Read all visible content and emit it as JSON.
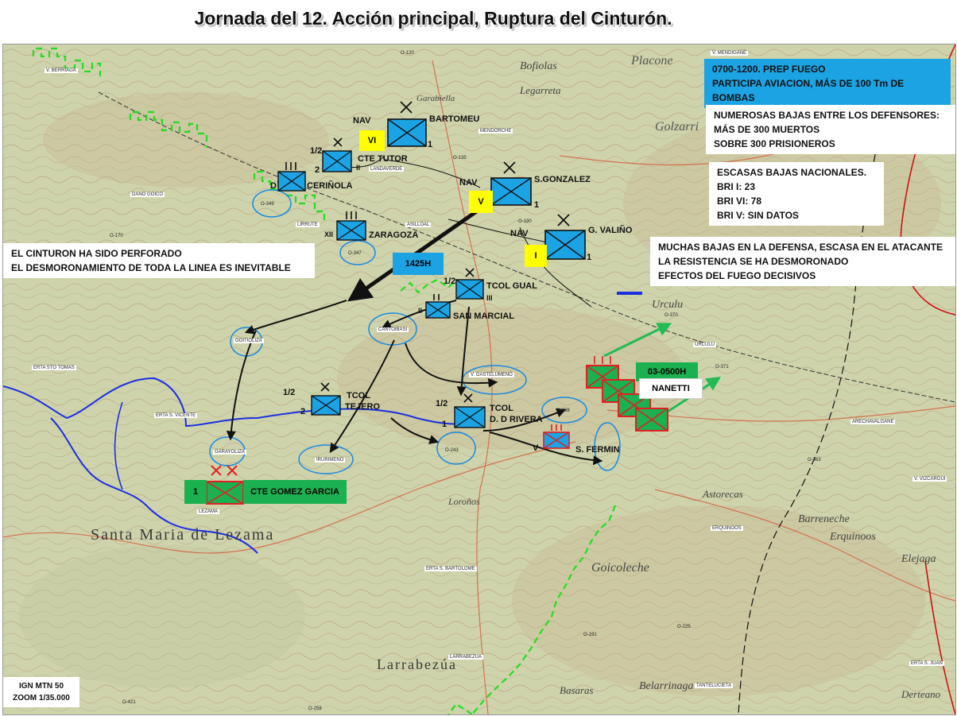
{
  "title": "Jornada del 12. Acción principal, Ruptura del Cinturón.",
  "colors": {
    "friendly": "#1ba3e4",
    "enemy": "#e02020",
    "enemy_fill": "#1bb050",
    "front": "#22dd22",
    "river": "#1a2fe0",
    "border": "#cc1111",
    "arrow": "#111111",
    "annotation_blue": "#1ba3e4"
  },
  "info_boxes": {
    "prep_fuego": [
      "0700-1200.  PREP FUEGO",
      "PARTICIPA AVIACION, MÁS DE 100 Tm DE BOMBAS"
    ],
    "bajas_def": [
      "NUMEROSAS BAJAS ENTRE LOS DEFENSORES:",
      "MÁS DE 300 MUERTOS",
      "SOBRE 300 PRISIONEROS"
    ],
    "bajas_nac": [
      "ESCASAS BAJAS NACIONALES.",
      "BRI I: 23",
      "BRI VI: 78",
      "BRI V: SIN DATOS"
    ],
    "resistencia": [
      "MUCHAS BAJAS EN LA DEFENSA, ESCASA EN EL ATACANTE",
      "LA RESISTENCIA SE HA DESMORONADO",
      "EFECTOS DEL FUEGO DECISIVOS"
    ],
    "cinturon": [
      "EL CINTURON HA SIDO PERFORADO",
      "EL DESMORONAMIENTO DE TODA LA LINEA ES INEVITABLE"
    ],
    "ign": [
      "IGN MTN 50",
      "ZOOM 1/35.000"
    ]
  },
  "tags": {
    "vi": "VI",
    "v": "V",
    "i": "I",
    "t1425": "1425H",
    "t0305": "03-0500H",
    "nanetti": "NANETTI",
    "gomez_num": "1",
    "gomez": "CTE GOMEZ GARCIA"
  },
  "units": {
    "bartomeu": {
      "name": "BARTOMEU",
      "nav": "NAV",
      "num": "1"
    },
    "tutor": {
      "name": "CTE TUTOR",
      "pre": "1/2",
      "num": "2",
      "suffix": "II"
    },
    "ceriñola": {
      "name": "CERIÑOLA",
      "pre": "D"
    },
    "zaragoza": {
      "name": "ZARAGOZA",
      "pre": "XII"
    },
    "sgonzalez": {
      "name": "S.GONZALEZ",
      "nav": "NAV",
      "num": "1"
    },
    "valiño": {
      "name": "G. VALIÑO",
      "nav": "NAV",
      "num": "1"
    },
    "gual": {
      "name": "TCOL GUAL",
      "pre": "1/2",
      "suffix": "III"
    },
    "sanmarcial": {
      "name": "SAN MARCIAL",
      "pre": "II"
    },
    "tejero": {
      "line1": "TCOL",
      "line2": "TEJERO",
      "pre": "1/2",
      "num": "2"
    },
    "rivera": {
      "line1": "TCOL",
      "line2": "D. D RIVERA",
      "pre": "1/2",
      "num": "1"
    },
    "sfermin": {
      "name": "S. FERMIN",
      "pre": "V"
    }
  },
  "place_labels": [
    {
      "id": "berriaga",
      "text": "V. BERRIAGA"
    },
    {
      "id": "mendigane",
      "text": "V. MENDIGANE"
    },
    {
      "id": "dano",
      "text": "DANO GOICO"
    },
    {
      "id": "lirrute",
      "text": "LIRRUTE"
    },
    {
      "id": "asillo",
      "text": "ASILLOAL"
    },
    {
      "id": "landaverde",
      "text": "LANDAVERDE"
    },
    {
      "id": "mendorche",
      "text": "MENDORCHE"
    },
    {
      "id": "erta_sto",
      "text": "ERTA STO TOMAS"
    },
    {
      "id": "erta_sv",
      "text": "ERTA S. VICENTE"
    },
    {
      "id": "erta_sb",
      "text": "ERTA S. BARTOLOME"
    },
    {
      "id": "goitioliza",
      "text": "GOITIOLIZA"
    },
    {
      "id": "cantoibasi",
      "text": "CANTOIBASI"
    },
    {
      "id": "garayoliza",
      "text": "GARAYOLIZA"
    },
    {
      "id": "irurimeno",
      "text": "IRURIMENO"
    },
    {
      "id": "gastelu",
      "text": "V. GASTELUMENO"
    },
    {
      "id": "urculu",
      "text": "URCULU"
    },
    {
      "id": "arechavalgane",
      "text": "ARECHAVALGANE"
    },
    {
      "id": "vizcargui",
      "text": "V. VIZCARGUI"
    },
    {
      "id": "erquinoos",
      "text": "ERQUINOOS"
    },
    {
      "id": "larrabezua",
      "text": "LARRABEZUA"
    },
    {
      "id": "tantelucieta",
      "text": "TANTELUCIETA"
    },
    {
      "id": "sjuan",
      "text": "ERTA S. JUAN"
    },
    {
      "id": "lezama",
      "text": "LEZAMA"
    }
  ],
  "map_text": [
    {
      "id": "santa_maria",
      "text": "Santa Maria de Lezama"
    },
    {
      "id": "larrab",
      "text": "Larrabezúa"
    },
    {
      "id": "bofiolas",
      "text": "Bofiolas"
    },
    {
      "id": "legarreta",
      "text": "Legarreta"
    },
    {
      "id": "placone",
      "text": "Placone"
    },
    {
      "id": "golzarri",
      "text": "Golzarri"
    },
    {
      "id": "goicoleche",
      "text": "Goicoleche"
    },
    {
      "id": "astorecas",
      "text": "Astorecas"
    },
    {
      "id": "barreneche",
      "text": "Barreneche"
    },
    {
      "id": "erquinoos_t",
      "text": "Erquinoos"
    },
    {
      "id": "elejaga",
      "text": "Elejaga"
    },
    {
      "id": "derteano",
      "text": "Derteano"
    },
    {
      "id": "belarrinaga",
      "text": "Belarrinaga"
    },
    {
      "id": "basaras",
      "text": "Basaras"
    },
    {
      "id": "urculu_t",
      "text": "Urculu"
    },
    {
      "id": "loronos",
      "text": "Loroños"
    },
    {
      "id": "garabiella",
      "text": "Garabiella"
    }
  ],
  "road_codes": [
    {
      "id": "c120",
      "text": "O-120"
    },
    {
      "id": "c135",
      "text": "O-135"
    },
    {
      "id": "c190",
      "text": "O-190"
    },
    {
      "id": "c170",
      "text": "O-170"
    },
    {
      "id": "c349",
      "text": "O-349"
    },
    {
      "id": "c347",
      "text": "O-347"
    },
    {
      "id": "c370",
      "text": "O-370"
    },
    {
      "id": "c371",
      "text": "O-371"
    },
    {
      "id": "c238",
      "text": "O-238"
    },
    {
      "id": "c243",
      "text": "O-243"
    },
    {
      "id": "c363",
      "text": "O-363"
    },
    {
      "id": "c191",
      "text": "O-191"
    },
    {
      "id": "c225",
      "text": "O-225"
    },
    {
      "id": "c421",
      "text": "O-421"
    },
    {
      "id": "c258",
      "text": "O-258"
    }
  ]
}
